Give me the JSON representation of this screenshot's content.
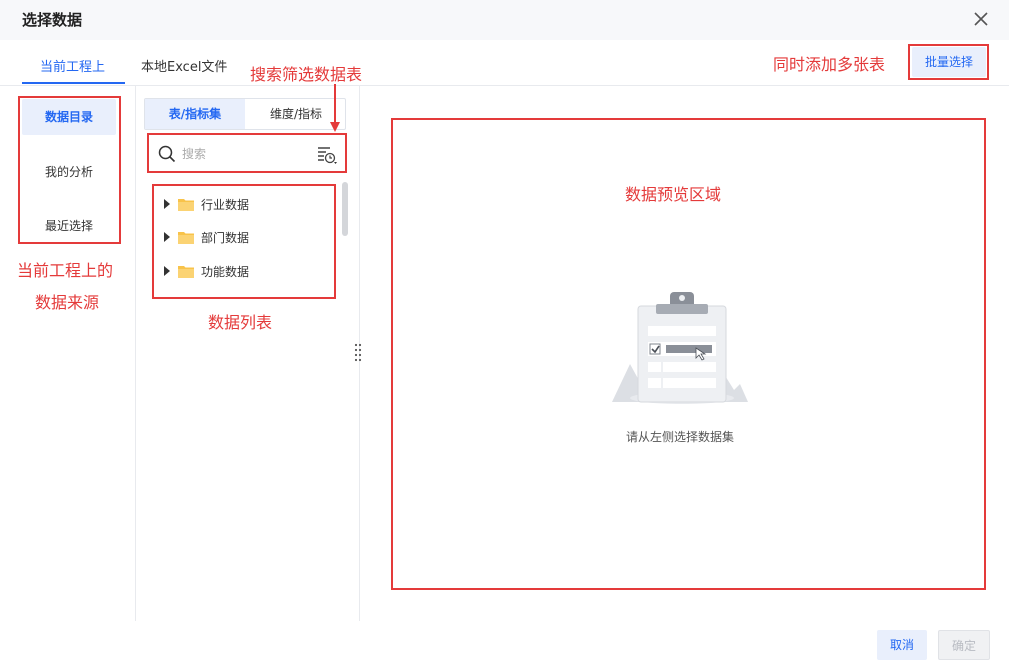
{
  "dialog": {
    "title": "选择数据",
    "close_icon": "close-icon"
  },
  "tabs": [
    {
      "label": "当前工程上",
      "active": true
    },
    {
      "label": "本地Excel文件",
      "active": false
    }
  ],
  "batch_button": "批量选择",
  "left_nav": {
    "items": [
      {
        "label": "数据目录",
        "active": true
      },
      {
        "label": "我的分析",
        "active": false
      },
      {
        "label": "最近选择",
        "active": false
      }
    ]
  },
  "segment": {
    "items": [
      {
        "label": "表/指标集",
        "active": true
      },
      {
        "label": "维度/指标",
        "active": false
      }
    ]
  },
  "search": {
    "placeholder": "搜索",
    "value": "",
    "icon": "search-icon",
    "filter_icon": "filter-history-icon"
  },
  "tree": {
    "items": [
      {
        "label": "行业数据",
        "icon": "folder-icon"
      },
      {
        "label": "部门数据",
        "icon": "folder-icon"
      },
      {
        "label": "功能数据",
        "icon": "folder-icon"
      }
    ]
  },
  "preview": {
    "empty_text": "请从左侧选择数据集",
    "illustration_icon": "clipboard-empty-icon"
  },
  "footer": {
    "cancel": "取消",
    "confirm": "确定",
    "confirm_disabled": true
  },
  "annotations": {
    "search_filter": "搜索筛选数据表",
    "batch_add": "同时添加多张表",
    "data_source_line1": "当前工程上的",
    "data_source_line2": "数据来源",
    "data_list": "数据列表",
    "preview_area": "数据预览区域"
  },
  "colors": {
    "accent": "#2468f2",
    "accent_bg": "#e9effc",
    "annotation": "#e43a3a",
    "folder": "#f8c34a"
  }
}
